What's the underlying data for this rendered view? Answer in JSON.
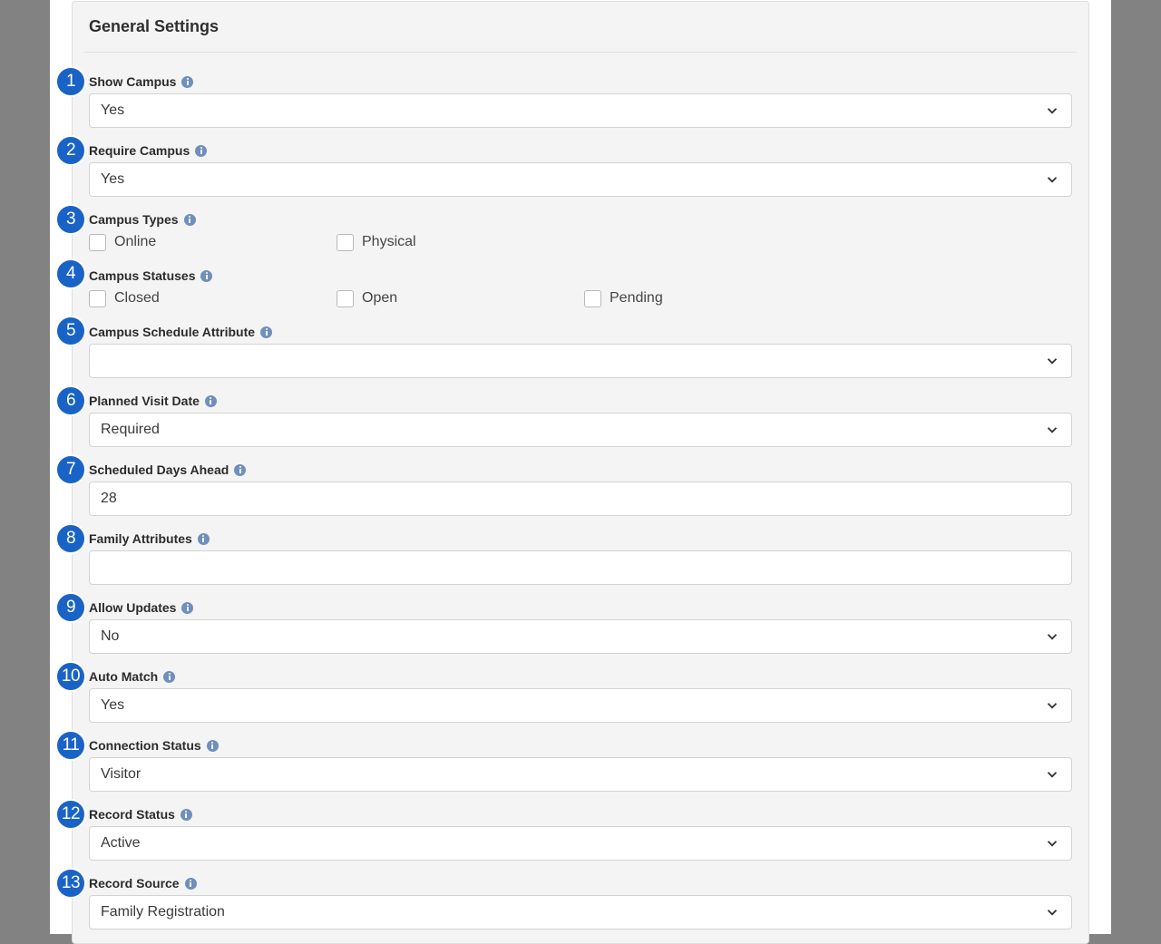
{
  "panel": {
    "title": "General Settings"
  },
  "fields": [
    {
      "number": "1",
      "label": "Show Campus",
      "type": "select",
      "value": "Yes"
    },
    {
      "number": "2",
      "label": "Require Campus",
      "type": "select",
      "value": "Yes"
    },
    {
      "number": "3",
      "label": "Campus Types",
      "type": "checkboxes",
      "options": [
        "Online",
        "Physical"
      ]
    },
    {
      "number": "4",
      "label": "Campus Statuses",
      "type": "checkboxes",
      "options": [
        "Closed",
        "Open",
        "Pending"
      ]
    },
    {
      "number": "5",
      "label": "Campus Schedule Attribute",
      "type": "select",
      "value": ""
    },
    {
      "number": "6",
      "label": "Planned Visit Date",
      "type": "select",
      "value": "Required"
    },
    {
      "number": "7",
      "label": "Scheduled Days Ahead",
      "type": "text",
      "value": "28"
    },
    {
      "number": "8",
      "label": "Family Attributes",
      "type": "text",
      "value": ""
    },
    {
      "number": "9",
      "label": "Allow Updates",
      "type": "select",
      "value": "No"
    },
    {
      "number": "10",
      "label": "Auto Match",
      "type": "select",
      "value": "Yes"
    },
    {
      "number": "11",
      "label": "Connection Status",
      "type": "select",
      "value": "Visitor"
    },
    {
      "number": "12",
      "label": "Record Status",
      "type": "select",
      "value": "Active"
    },
    {
      "number": "13",
      "label": "Record Source",
      "type": "select",
      "value": "Family Registration"
    }
  ],
  "icons": {
    "info": "info-icon",
    "dropdown": "chevron-down-icon"
  },
  "colors": {
    "badge": "#1a63c6",
    "info_icon": "#6f8fbd",
    "panel_bg": "#f4f4f4",
    "backdrop": "#828282"
  }
}
